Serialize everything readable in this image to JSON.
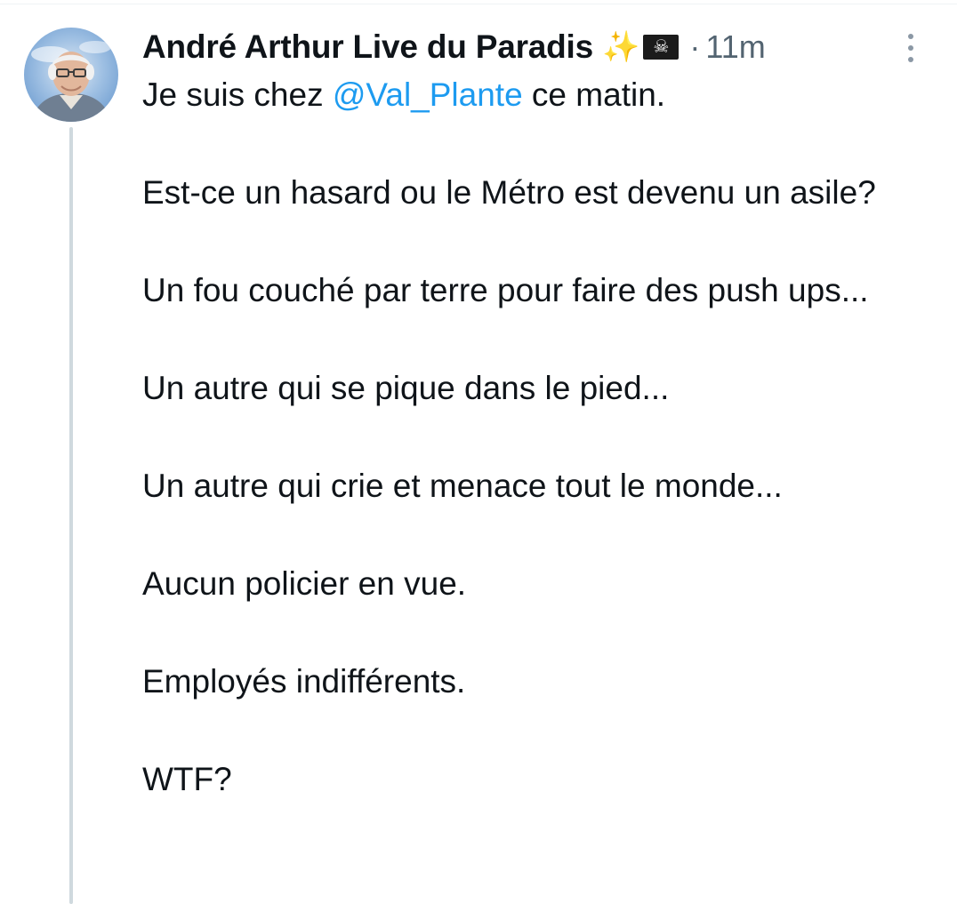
{
  "tweet": {
    "author": {
      "display_name": "André Arthur Live du Paradis",
      "name_emojis": [
        "✨",
        "☠"
      ],
      "avatar_icon": "avatar-portrait"
    },
    "timestamp": "11m",
    "separator": "·",
    "more_icon": "more-dots-icon",
    "body": {
      "line1_before": "Je suis chez ",
      "mention": "@Val_Plante",
      "line1_after": " ce matin.",
      "paragraphs": [
        "Est-ce un hasard ou le Métro est devenu un asile?",
        "Un fou couché par terre pour faire des push ups...",
        "Un autre qui se pique dans le pied...",
        "Un autre qui crie et menace tout le monde...",
        "Aucun policier en vue.",
        "Employés indifférents.",
        "WTF?"
      ]
    }
  },
  "colors": {
    "text": "#0f1419",
    "secondary": "#536471",
    "link": "#1d9bf0",
    "thread_line": "#cfd9de"
  }
}
